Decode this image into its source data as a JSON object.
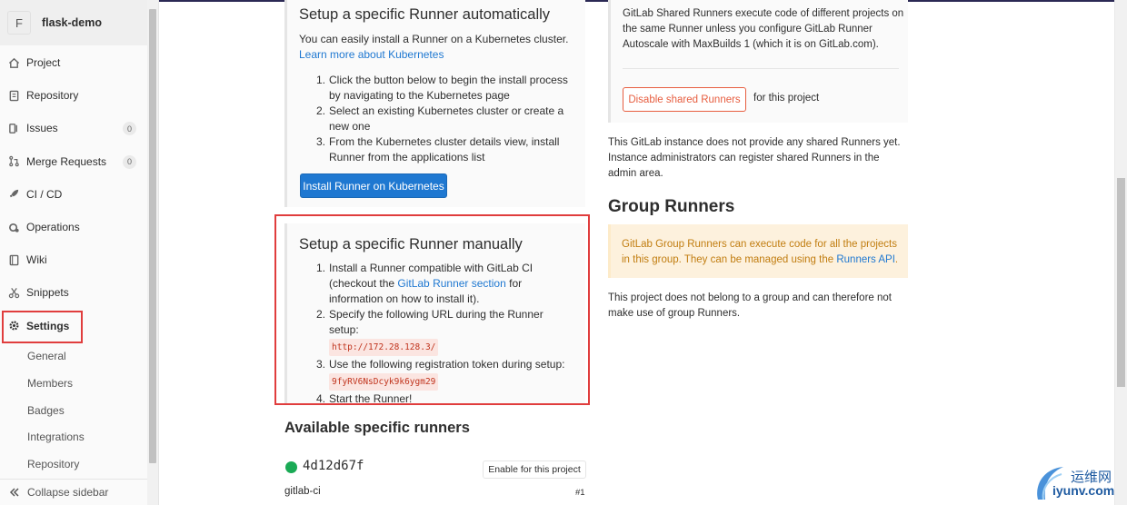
{
  "project": {
    "avatar_letter": "F",
    "name": "flask-demo"
  },
  "nav": [
    {
      "label": "Project",
      "icon": "home-icon"
    },
    {
      "label": "Repository",
      "icon": "doc-icon"
    },
    {
      "label": "Issues",
      "icon": "issues-icon",
      "count": "0"
    },
    {
      "label": "Merge Requests",
      "icon": "merge-icon",
      "count": "0"
    },
    {
      "label": "CI / CD",
      "icon": "rocket-icon"
    },
    {
      "label": "Operations",
      "icon": "cloud-gear-icon"
    },
    {
      "label": "Wiki",
      "icon": "book-icon"
    },
    {
      "label": "Snippets",
      "icon": "scissors-icon"
    },
    {
      "label": "Settings",
      "icon": "gear-icon"
    }
  ],
  "settings_sub": [
    "General",
    "Members",
    "Badges",
    "Integrations",
    "Repository"
  ],
  "collapse_label": "Collapse sidebar",
  "auto": {
    "title": "Setup a specific Runner automatically",
    "intro": "You can easily install a Runner on a Kubernetes cluster.",
    "learn_more": "Learn more about Kubernetes",
    "steps": [
      "Click the button below to begin the install process by navigating to the Kubernetes page",
      "Select an existing Kubernetes cluster or create a new one",
      "From the Kubernetes cluster details view, install Runner from the applications list"
    ],
    "button": "Install Runner on Kubernetes"
  },
  "manual": {
    "title": "Setup a specific Runner manually",
    "step1_pre": "Install a Runner compatible with GitLab CI (checkout the ",
    "step1_link": "GitLab Runner section",
    "step1_post": " for information on how to install it).",
    "step2": "Specify the following URL during the Runner setup:",
    "url": "http://172.28.128.3/",
    "step3": "Use the following registration token during setup:",
    "token": "9fyRV6NsDcyk9k6ygm29",
    "step4": "Start the Runner!"
  },
  "available": {
    "title": "Available specific runners",
    "runner_id": "4d12d67f",
    "enable_button": "Enable for this project",
    "runner_desc": "gitlab-ci",
    "runner_num": "#1"
  },
  "shared": {
    "text": "GitLab Shared Runners execute code of different projects on the same Runner unless you configure GitLab Runner Autoscale with MaxBuilds 1 (which it is on GitLab.com).",
    "disable_button": "Disable shared Runners",
    "for_project": "for this project",
    "no_shared": "This GitLab instance does not provide any shared Runners yet. Instance administrators can register shared Runners in the admin area."
  },
  "group": {
    "title": "Group Runners",
    "note": "GitLab Group Runners can execute code for all the projects in this group. They can be managed using the ",
    "note_link": "Runners API",
    "note_end": ".",
    "no_group": "This project does not belong to a group and can therefore not make use of group Runners."
  },
  "watermark": {
    "cn": "运维网",
    "en": "iyunv.com"
  },
  "colors": {
    "accent_blue": "#1f78d1",
    "danger_orange": "#e75e40",
    "success_green": "#1aaa55",
    "highlight_red": "#e03d3d"
  }
}
